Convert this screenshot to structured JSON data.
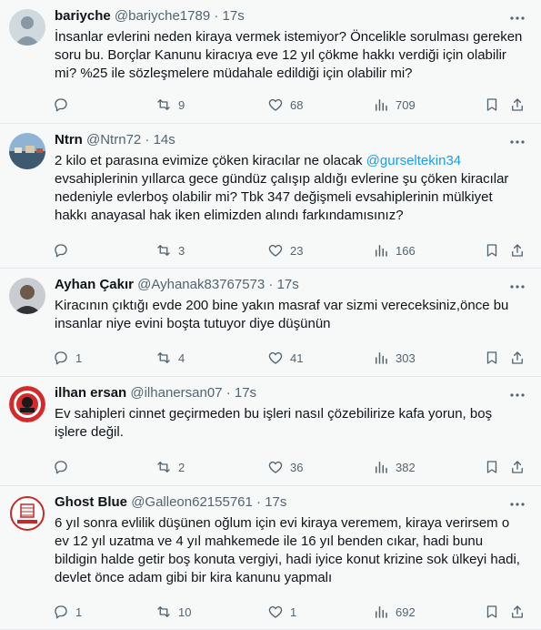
{
  "tweets": [
    {
      "name": "bariyche",
      "handle": "@bariyche1789",
      "time": "17s",
      "text": "İnsanlar evlerini neden kiraya vermek istemiyor? Öncelikle sorulması gereken soru bu. Borçlar Kanunu kiracıya eve 12 yıl çökme hakkı verdiği için olabilir mi? %25 ile sözleşmelere müdahale edildiği için olabilir mi?",
      "replies": "",
      "retweets": "9",
      "likes": "68",
      "views": "709"
    },
    {
      "name": "Ntrn",
      "handle": "@Ntrn72",
      "time": "14s",
      "text_before": "2 kilo et parasına evimize çöken kiracılar ne olacak ",
      "mention": "@gurseltekin34",
      "text_after": " evsahiplerinin yıllarca gece gündüz çalışıp aldığı evlerine şu çöken kiracılar nedeniyle evlerboş olabilir mi? Tbk 347 değişmeli evsahiplerinin mülkiyet hakkı anayasal hak iken elimizden alındı farkındamısınız?",
      "replies": "",
      "retweets": "3",
      "likes": "23",
      "views": "166"
    },
    {
      "name": "Ayhan Çakır",
      "handle": "@Ayhanak83767573",
      "time": "17s",
      "text": "Kiracının çıktığı evde 200 bine yakın masraf var sizmi vereceksiniz,önce bu insanlar niye evini boşta tutuyor diye düşünün",
      "replies": "1",
      "retweets": "4",
      "likes": "41",
      "views": "303"
    },
    {
      "name": "ilhan ersan",
      "handle": "@ilhanersan07",
      "time": "17s",
      "text": "Ev sahipleri cinnet geçirmeden bu işleri nasıl çözebilirize kafa yorun, boş işlere değil.",
      "replies": "",
      "retweets": "2",
      "likes": "36",
      "views": "382"
    },
    {
      "name": "Ghost Blue",
      "handle": "@Galleon62155761",
      "time": "17s",
      "text": "6 yıl sonra evlilik düşünen oğlum için evi kiraya veremem, kiraya verirsem o ev 12 yıl uzatma ve 4 yıl mahkemede ile 16 yıl benden cıkar, hadi  bunu bildigin halde getir boş konuta vergiyi, hadi iyice konut krizine sok ülkeyi hadi, devlet önce adam gibi bir kira kanunu yapmalı",
      "replies": "1",
      "retweets": "10",
      "likes": "1",
      "views": "692"
    }
  ],
  "header_dot": "·",
  "icons": {
    "reply": "reply-icon",
    "retweet": "retweet-icon",
    "like": "heart-icon",
    "views": "views-icon",
    "bookmark": "bookmark-icon",
    "share": "share-icon",
    "more": "more-icon"
  }
}
